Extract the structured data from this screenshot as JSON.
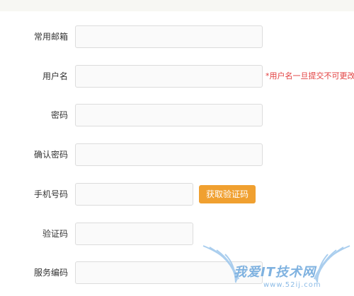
{
  "form": {
    "email": {
      "label": "常用邮箱",
      "value": ""
    },
    "username": {
      "label": "用户名",
      "value": "",
      "hint": "*用户名一旦提交不可更改"
    },
    "password": {
      "label": "密码",
      "value": ""
    },
    "confirm_password": {
      "label": "确认密码",
      "value": ""
    },
    "phone": {
      "label": "手机号码",
      "value": "",
      "send_code_button": "获取验证码"
    },
    "verification_code": {
      "label": "验证码",
      "value": ""
    },
    "service_code": {
      "label": "服务编码",
      "value": ""
    }
  },
  "watermark": {
    "text": "我爱IT技术网",
    "url": "www.52ij.com"
  },
  "colors": {
    "accent": "#f0a030",
    "hint": "#e23c3c",
    "watermark": "#7fb2e0"
  },
  "icons": {
    "watermark_logo": "fountain-pen-wings-icon"
  }
}
